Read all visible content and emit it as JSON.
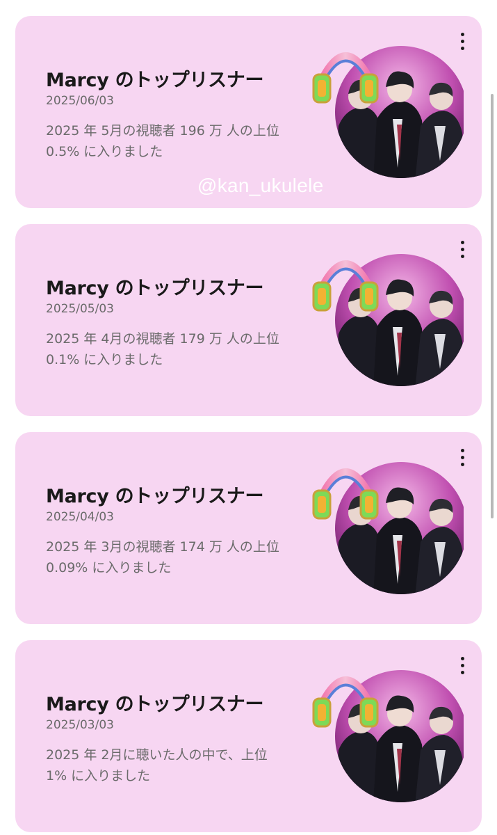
{
  "cards": [
    {
      "title": "Marcy のトップリスナー",
      "date": "2025/06/03",
      "description": "2025 年 5月の視聴者 196 万 人の上位 0.5% に入りました",
      "more_icon": "more-vert-icon",
      "thumbnail_icon": "headphones-icon"
    },
    {
      "title": "Marcy のトップリスナー",
      "date": "2025/05/03",
      "description": "2025 年 4月の視聴者 179 万 人の上位 0.1% に入りました",
      "more_icon": "more-vert-icon",
      "thumbnail_icon": "headphones-icon"
    },
    {
      "title": "Marcy のトップリスナー",
      "date": "2025/04/03",
      "description": "2025 年 3月の視聴者 174 万 人の上位 0.09% に入りました",
      "more_icon": "more-vert-icon",
      "thumbnail_icon": "headphones-icon"
    },
    {
      "title": "Marcy のトップリスナー",
      "date": "2025/03/03",
      "description": "2025 年 2月に聴いた人の中で、上位 1% に入りました",
      "more_icon": "more-vert-icon",
      "thumbnail_icon": "headphones-icon"
    }
  ],
  "watermark": "@kan_ukulele",
  "colors": {
    "card_background": "#f7d6f2",
    "title": "#1a1a1a",
    "secondary_text": "#6b6b6b",
    "page_background": "#ffffff"
  }
}
